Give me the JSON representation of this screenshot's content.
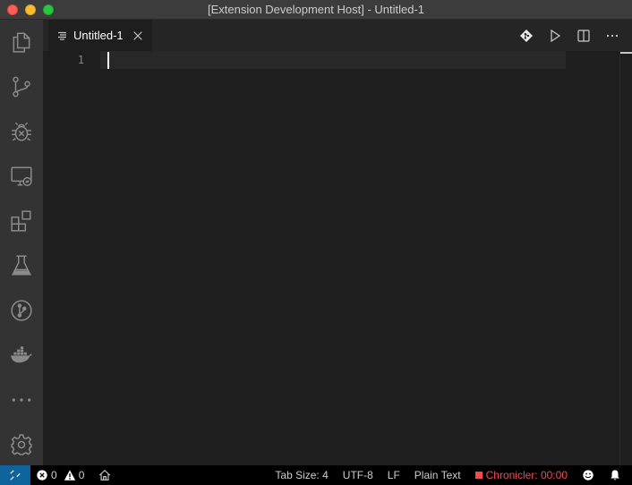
{
  "window": {
    "title": "[Extension Development Host] - Untitled-1"
  },
  "activity_bar": {
    "items": [
      {
        "name": "explorer",
        "icon": "files-icon"
      },
      {
        "name": "source-control",
        "icon": "source-control-icon"
      },
      {
        "name": "run-debug",
        "icon": "debug-icon"
      },
      {
        "name": "remote-explorer",
        "icon": "remote-explorer-icon"
      },
      {
        "name": "extensions",
        "icon": "extensions-icon"
      },
      {
        "name": "testing",
        "icon": "beaker-icon"
      },
      {
        "name": "git-graph",
        "icon": "git-graph-icon"
      },
      {
        "name": "docker",
        "icon": "docker-icon"
      },
      {
        "name": "more",
        "icon": "ellipsis-icon"
      },
      {
        "name": "manage",
        "icon": "gear-icon"
      }
    ]
  },
  "tabs": [
    {
      "label": "Untitled-1",
      "active": true
    }
  ],
  "editor": {
    "line_numbers": [
      "1"
    ]
  },
  "status_bar": {
    "errors": "0",
    "warnings": "0",
    "tab_size": "Tab Size: 4",
    "encoding": "UTF-8",
    "eol": "LF",
    "language": "Plain Text",
    "chronicler": "Chronicler: 00:00"
  },
  "colors": {
    "accent": "#0e639c",
    "chronicler": "#f14c4c"
  }
}
